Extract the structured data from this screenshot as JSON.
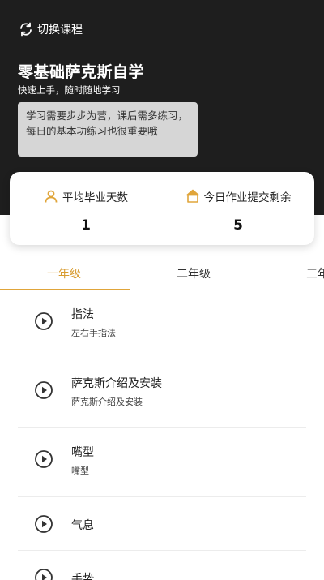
{
  "header": {
    "switch_label": "切换课程",
    "course_title": "零基础萨克斯自学",
    "course_subtitle": "快速上手，随时随地学习",
    "tip": "学习需要步步为营，课后需多练习，每日的基本功练习也很重要哦"
  },
  "stats": [
    {
      "icon": "person-icon",
      "label": "平均毕业天数",
      "value": "1"
    },
    {
      "icon": "upload-icon",
      "label": "今日作业提交剩余",
      "value": "5"
    }
  ],
  "tabs": [
    {
      "label": "一年级",
      "active": true
    },
    {
      "label": "二年级",
      "active": false
    },
    {
      "label": "三年级",
      "active": false
    }
  ],
  "lessons": [
    {
      "title": "指法",
      "subtitle": "左右手指法"
    },
    {
      "title": "萨克斯介绍及安装",
      "subtitle": "萨克斯介绍及安装"
    },
    {
      "title": "嘴型",
      "subtitle": "嘴型"
    },
    {
      "title": "气息",
      "subtitle": ""
    },
    {
      "title": "手势",
      "subtitle": ""
    }
  ],
  "colors": {
    "accent": "#e0a53a",
    "header_bg": "#1e1e1e",
    "tip_bg": "#d6d6d6"
  }
}
